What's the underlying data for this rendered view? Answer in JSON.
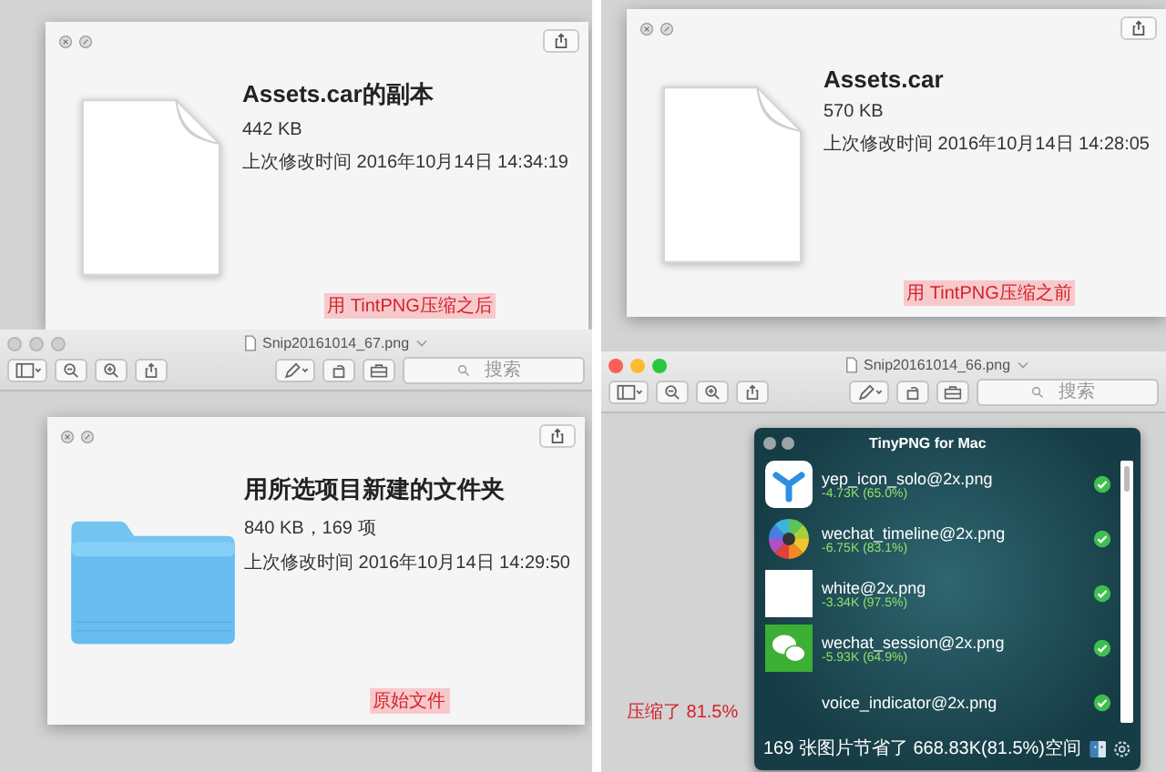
{
  "panels": [
    {
      "content": {
        "kind": "document",
        "name": "Assets.car的副本",
        "size": "442 KB",
        "modified": "上次修改时间 2016年10月14日 14:34:19",
        "note": "用 TintPNG压缩之后"
      }
    },
    {
      "content": {
        "kind": "document",
        "name": "Assets.car",
        "size": "570 KB",
        "modified": "上次修改时间 2016年10月14日 14:28:05",
        "note": "用 TintPNG压缩之前"
      }
    },
    {
      "toolbar": {
        "title": "Snip20161014_67.png",
        "active": false,
        "search_placeholder": "搜索"
      },
      "content": {
        "kind": "folder",
        "name": "用所选项目新建的文件夹",
        "size": "840 KB，169 项",
        "modified": "上次修改时间 2016年10月14日 14:29:50",
        "note": "原始文件"
      }
    },
    {
      "toolbar": {
        "title": "Snip20161014_66.png",
        "active": true,
        "search_placeholder": "搜索"
      },
      "content": {
        "kind": "tinypng",
        "note": "压缩了 81.5%",
        "title": "TinyPNG for Mac",
        "footer": "169 张图片节省了 668.83K(81.5%)空间",
        "files": [
          {
            "kind": "app",
            "name": "yep_icon_solo@2x.png",
            "saving": "-4.73K (65.0%)",
            "done": true
          },
          {
            "kind": "wheel",
            "name": "wechat_timeline@2x.png",
            "saving": "-6.75K (83.1%)",
            "done": true
          },
          {
            "kind": "blank",
            "name": "white@2x.png",
            "saving": "-3.34K (97.5%)",
            "done": true
          },
          {
            "kind": "chat",
            "name": "wechat_session@2x.png",
            "saving": "-5.93K (64.9%)",
            "done": true
          },
          {
            "name": "voice_indicator@2x.png",
            "done": true
          }
        ]
      }
    }
  ]
}
